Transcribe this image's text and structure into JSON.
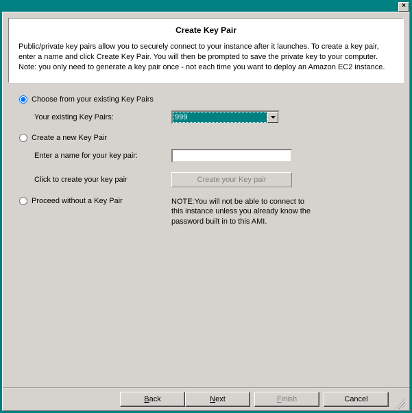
{
  "window": {
    "close_glyph": "×"
  },
  "header": {
    "title": "Create Key Pair",
    "description": "Public/private key pairs allow you to securely connect to your instance after it launches. To create a key pair, enter a name and click  Create  Key Pair. You will then be prompted to save the private key to your computer. Note: you only need to generate a key pair once - not each time you want to deploy an Amazon EC2 instance."
  },
  "options": {
    "choose_existing": {
      "label": "Choose from your existing Key Pairs",
      "sub_label": "Your existing Key Pairs:",
      "selected_value": "999",
      "selected": true
    },
    "create_new": {
      "label": "Create a new Key Pair",
      "name_label": "Enter a name for your key pair:",
      "name_value": "",
      "create_label": "Click to create your key pair",
      "create_button": "Create your Key pair",
      "selected": false
    },
    "proceed_without": {
      "label": "Proceed without a Key Pair",
      "note": "NOTE:You will not be able to connect to this instance unless you already know the password built in to this AMI.",
      "selected": false
    }
  },
  "footer": {
    "back": "Back",
    "next": "Next",
    "finish": "Finish",
    "cancel": "Cancel"
  }
}
